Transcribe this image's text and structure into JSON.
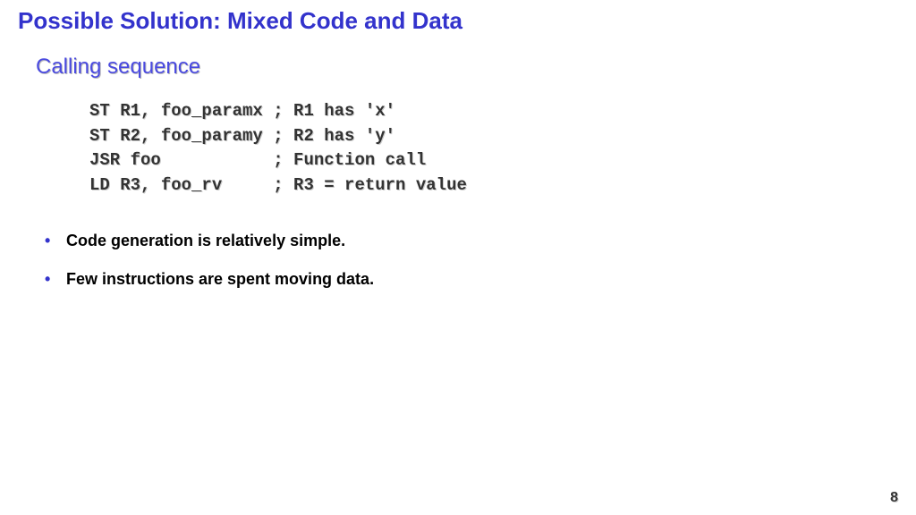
{
  "title": "Possible Solution: Mixed Code and Data",
  "subtitle": "Calling sequence",
  "code": {
    "line1": "ST R1, foo_paramx ; R1 has 'x'",
    "line2": "ST R2, foo_paramy ; R2 has 'y'",
    "line3": "JSR foo           ; Function call",
    "line4": "LD R3, foo_rv     ; R3 = return value"
  },
  "bullets": {
    "b1": "Code generation is relatively simple.",
    "b2": "Few instructions are spent moving data."
  },
  "page_number": "8"
}
